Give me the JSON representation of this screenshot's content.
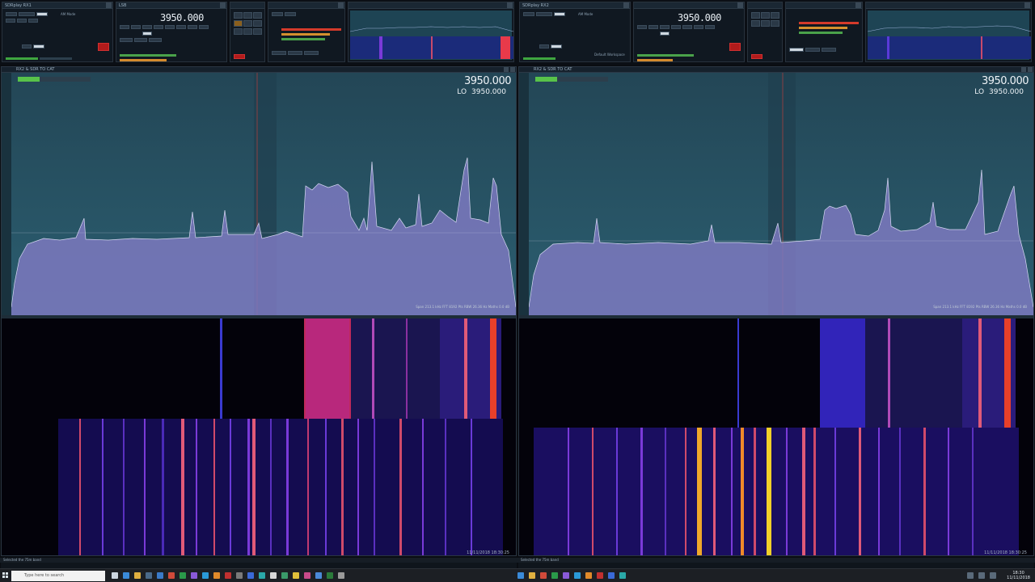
{
  "top_panels": {
    "left": {
      "rx_title": "SDRplay RX1",
      "frequency": "3950.000",
      "mode_text": "AM Mode",
      "band_label": "LSB",
      "nr_label": "NR",
      "af_label": "AF",
      "start_label": "Start",
      "stop_label": "Stop"
    },
    "right": {
      "rx_title": "SDRplay RX2",
      "frequency": "3950.000",
      "mode_text": "AM Mode",
      "workspace": "Default Workspace",
      "start_label": "Start",
      "stop_label": "Stop"
    }
  },
  "spectrum": {
    "left": {
      "title": "RX2 & SDR TO CAT",
      "freq_display": "3950.000",
      "lo_label": "LO",
      "lo_value": "3950.000",
      "span_info": "Span 213.1 kHz  FFT 8192 Pts  RBW 26.36 Hz  Maths 0.0 dB",
      "timestamp": "11/11/2018 18:30:25"
    },
    "right": {
      "title": "RX2 & SDR TO CAT",
      "freq_display": "3950.000",
      "lo_label": "LO",
      "lo_value": "3950.000",
      "span_info": "Span 213.1 kHz  FFT 8192 Pts  RBW 26.36 Hz  Maths 0.0 dB",
      "timestamp": "11/11/2018 18:30:25"
    }
  },
  "status": {
    "left_status": "Selected the 75m band",
    "right_status": "Selected the 75m band"
  },
  "taskbar": {
    "search_placeholder": "Type here to search",
    "clock_time": "18:30",
    "clock_date": "11/11/2018"
  },
  "colors": {
    "spectrum_bg": "#2b5e70",
    "trace_fill": "#7c79c0",
    "waterfall_bg": "#03020a",
    "accent_red": "#b21b1b"
  }
}
